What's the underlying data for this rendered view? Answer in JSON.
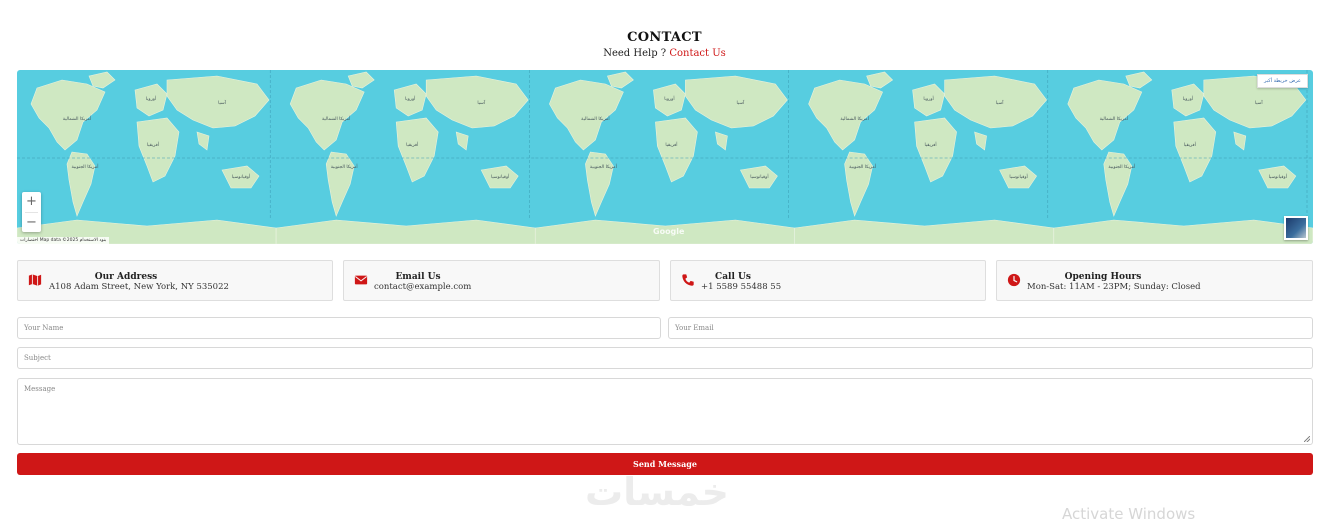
{
  "header": {
    "title": "CONTACT",
    "subtitle_prefix": "Need Help ?",
    "subtitle_link": "Contact Us"
  },
  "map": {
    "button_label": "عرض خريطة أكبر",
    "zoom_in": "+",
    "zoom_out": "−",
    "google_mark": "Google",
    "attribution": "اختصارات  Map data ©2025  بنود الاستخدام",
    "continent_labels": [
      "أمريكا الشمالية",
      "أوروبا",
      "آسيا",
      "أفريقيا",
      "أمريكا الجنوبية",
      "أوقيانوسيا"
    ],
    "water_color": "#57cde0",
    "land_color": "#cfe8c2"
  },
  "info_cards": [
    {
      "icon": "map-icon",
      "title": "Our Address",
      "value": "A108 Adam Street, New York, NY 535022"
    },
    {
      "icon": "envelope-icon",
      "title": "Email Us",
      "value": "contact@example.com"
    },
    {
      "icon": "phone-icon",
      "title": "Call Us",
      "value": "+1 5589 55488 55"
    },
    {
      "icon": "clock-icon",
      "title": "Opening Hours",
      "value": "Mon-Sat: 11AM - 23PM; Sunday: Closed"
    }
  ],
  "form": {
    "name_placeholder": "Your Name",
    "email_placeholder": "Your Email",
    "subject_placeholder": "Subject",
    "message_placeholder": "Message",
    "send_label": "Send Message"
  },
  "watermarks": {
    "logo": "خمسات",
    "windows": "Activate Windows"
  },
  "colors": {
    "accent": "#cf1717",
    "card_bg": "#f8f8f8"
  }
}
